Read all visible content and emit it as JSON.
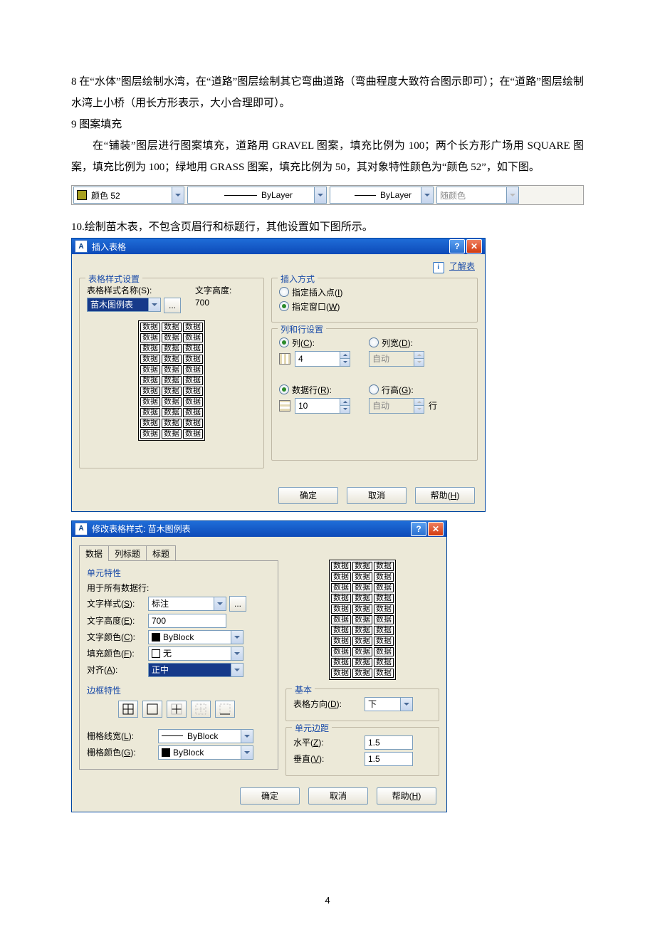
{
  "doc": {
    "p8": "8 在“水体”图层绘制水湾，在“道路”图层绘制其它弯曲道路（弯曲程度大致符合图示即可）；在“道路”图层绘制水湾上小桥（用长方形表示，大小合理即可）。",
    "p9_title": "9 图案填充",
    "p9_body": "在“铺装”图层进行图案填充，道路用 GRAVEL 图案，填充比例为 100；两个长方形广场用 SQUARE 图案，填充比例为 100；绿地用 GRASS 图案，填充比例为 50，其对象特性颜色为“颜色 52”，如下图。",
    "p10": "10.绘制苗木表，不包含页眉行和标题行，其他设置如下图所示。"
  },
  "propbar": {
    "color_label": "颜色 52",
    "color_hex": "#a8a020",
    "layer1": "ByLayer",
    "layer2": "ByLayer",
    "follow": "随颜色"
  },
  "dlg1": {
    "title": "插入表格",
    "learn": "了解表",
    "style_group": "表格样式设置",
    "style_name_label": "表格样式名称(S):",
    "style_name_value": "苗木图例表",
    "text_height_label": "文字高度:",
    "text_height_value": "700",
    "preview_cell": "数据",
    "preview_cols": 3,
    "preview_rows": 11,
    "insert_group": "插入方式",
    "insert_point": "指定插入点(I)",
    "insert_window": "指定窗口(W)",
    "insert_selected": "window",
    "rowcol_group": "列和行设置",
    "cols_label": "列(C):",
    "cols_value": "4",
    "colw_label": "列宽(D):",
    "colw_value": "自动",
    "rows_label": "数据行(R):",
    "rows_value": "10",
    "rowh_label": "行高(G):",
    "rowh_value": "自动",
    "rowh_unit": "行",
    "ok": "确定",
    "cancel": "取消",
    "help": "帮助(H)"
  },
  "dlg2": {
    "title": "修改表格样式: 苗木图例表",
    "tab_data": "数据",
    "tab_colhdr": "列标题",
    "tab_title": "标题",
    "cell_group": "单元特性",
    "apply_all": "用于所有数据行:",
    "text_style_label": "文字样式(S):",
    "text_style_value": "标注",
    "text_height_label": "文字高度(E):",
    "text_height_value": "700",
    "text_color_label": "文字颜色(C):",
    "text_color_value": "ByBlock",
    "fill_color_label": "填充颜色(F):",
    "fill_color_value": "无",
    "align_label": "对齐(A):",
    "align_value": "正中",
    "border_group": "边框特性",
    "grid_lw_label": "栅格线宽(L):",
    "grid_lw_value": "ByBlock",
    "grid_color_label": "栅格颜色(G):",
    "grid_color_value": "ByBlock",
    "preview_cell": "数据",
    "preview_cols": 3,
    "preview_rows": 11,
    "base_group": "基本",
    "dir_label": "表格方向(D):",
    "dir_value": "下",
    "margin_group": "单元边距",
    "margin_h_label": "水平(Z):",
    "margin_h_value": "1.5",
    "margin_v_label": "垂直(V):",
    "margin_v_value": "1.5",
    "ok": "确定",
    "cancel": "取消",
    "help": "帮助(H)"
  },
  "page_number": "4"
}
